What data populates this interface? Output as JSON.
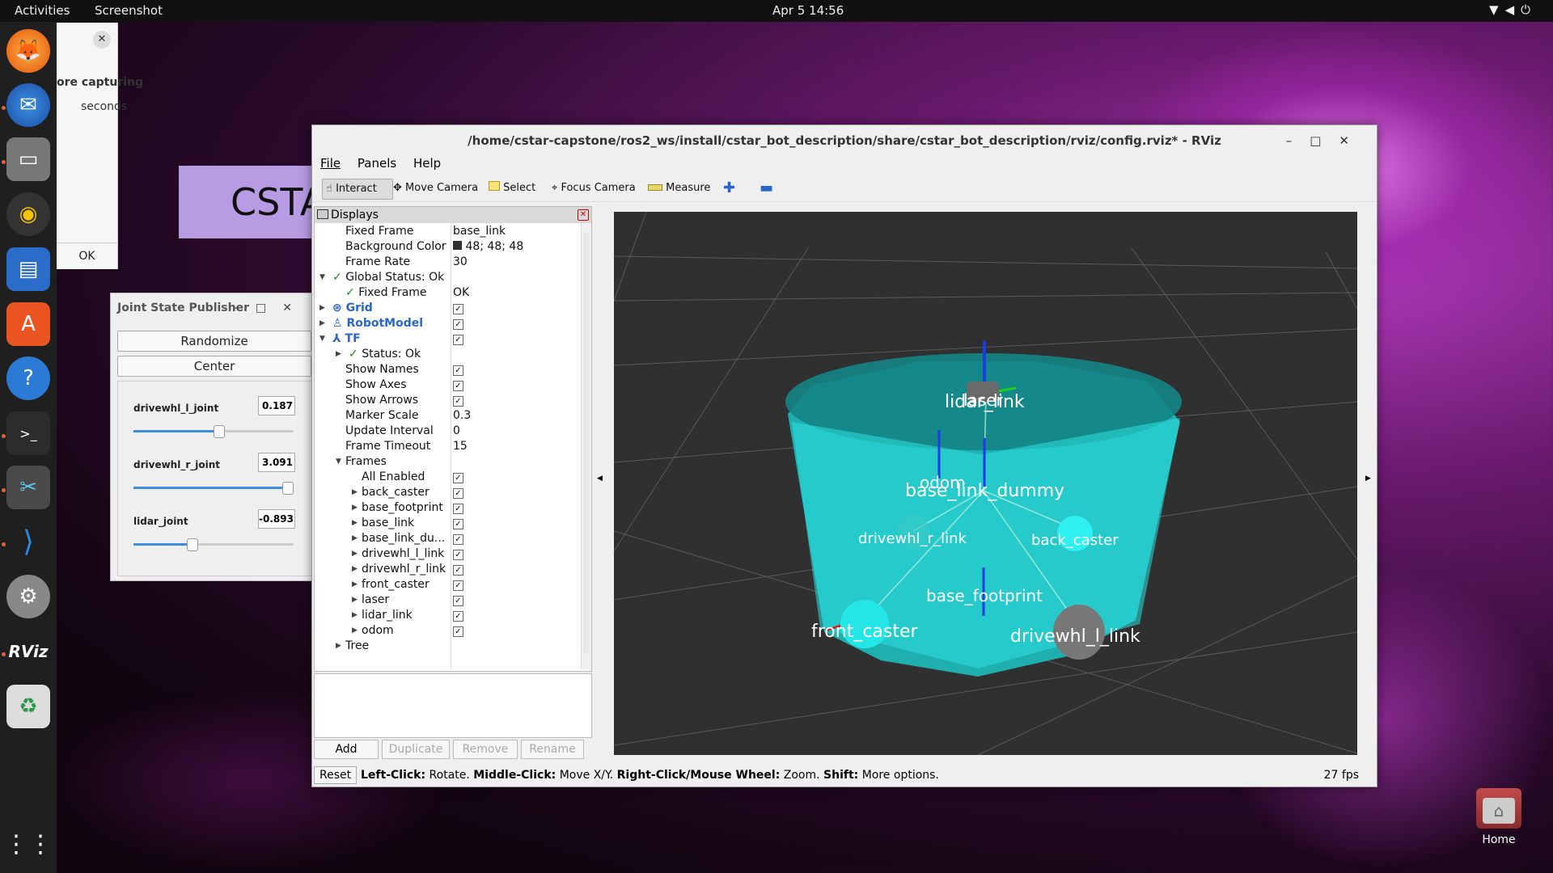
{
  "topbar": {
    "activities": "Activities",
    "app_name": "Screenshot",
    "clock": "Apr 5  14:56",
    "tray_icons": [
      "wifi-icon",
      "volume-icon",
      "power-icon"
    ]
  },
  "dock": {
    "items": [
      "firefox",
      "thunderbird",
      "files",
      "rhythmbox",
      "writer",
      "app-center",
      "help",
      "terminal",
      "screenshot",
      "vscode",
      "settings",
      "rviz",
      "trash"
    ],
    "rviz_label": "RViz"
  },
  "screenshot_dialog": {
    "line1": "ore capturing",
    "line2": "seconds",
    "ok": "OK"
  },
  "csta_card": {
    "text": "CSTA"
  },
  "joint_state_publisher": {
    "title": "Joint State Publisher",
    "randomize": "Randomize",
    "center": "Center",
    "joints": [
      {
        "name": "drivewhl_l_joint",
        "value": "0.187",
        "level": 0.55
      },
      {
        "name": "drivewhl_r_joint",
        "value": "3.091",
        "level": 0.98
      },
      {
        "name": "lidar_joint",
        "value": "-0.893",
        "level": 0.36
      }
    ]
  },
  "rviz": {
    "title": "/home/cstar-capstone/ros2_ws/install/cstar_bot_description/share/cstar_bot_description/rviz/config.rviz* - RViz",
    "menu": [
      "File",
      "Panels",
      "Help"
    ],
    "tools": [
      "Interact",
      "Move Camera",
      "Select",
      "Focus Camera",
      "Measure"
    ],
    "displays_title": "Displays",
    "tree": [
      {
        "k": "Fixed Frame",
        "v": "base_link"
      },
      {
        "k": "Background Color",
        "v": "48; 48; 48"
      },
      {
        "k": "Frame Rate",
        "v": "30"
      },
      {
        "k": "Global Status: Ok",
        "v": ""
      },
      {
        "k": "Fixed Frame",
        "v": "OK"
      },
      {
        "k": "Grid",
        "v": ""
      },
      {
        "k": "RobotModel",
        "v": ""
      },
      {
        "k": "TF",
        "v": ""
      },
      {
        "k": "Status: Ok",
        "v": ""
      },
      {
        "k": "Show Names",
        "v": ""
      },
      {
        "k": "Show Axes",
        "v": ""
      },
      {
        "k": "Show Arrows",
        "v": ""
      },
      {
        "k": "Marker Scale",
        "v": "0.3"
      },
      {
        "k": "Update Interval",
        "v": "0"
      },
      {
        "k": "Frame Timeout",
        "v": "15"
      },
      {
        "k": "Frames",
        "v": ""
      },
      {
        "k": "All Enabled",
        "v": ""
      },
      {
        "k": "back_caster",
        "v": ""
      },
      {
        "k": "base_footprint",
        "v": ""
      },
      {
        "k": "base_link",
        "v": ""
      },
      {
        "k": "base_link_du...",
        "v": ""
      },
      {
        "k": "drivewhl_l_link",
        "v": ""
      },
      {
        "k": "drivewhl_r_link",
        "v": ""
      },
      {
        "k": "front_caster",
        "v": ""
      },
      {
        "k": "laser",
        "v": ""
      },
      {
        "k": "lidar_link",
        "v": ""
      },
      {
        "k": "odom",
        "v": ""
      },
      {
        "k": "Tree",
        "v": ""
      }
    ],
    "buttons": [
      "Add",
      "Duplicate",
      "Remove",
      "Rename"
    ],
    "reset": "Reset",
    "help_bold": [
      "Left-Click:",
      "Middle-Click:",
      "Right-Click/Mouse Wheel:",
      "Shift:"
    ],
    "help_text": [
      " Rotate. ",
      " Move X/Y. ",
      " Zoom. ",
      " More options."
    ],
    "fps": "27 fps",
    "frame_labels": [
      "lidar_link",
      "laser",
      "odom",
      "base_link_dummy",
      "drivewhl_r_link",
      "back_caster",
      "base_footprint",
      "front_caster",
      "drivewhl_l_link"
    ]
  },
  "desktop": {
    "home_label": "Home"
  }
}
